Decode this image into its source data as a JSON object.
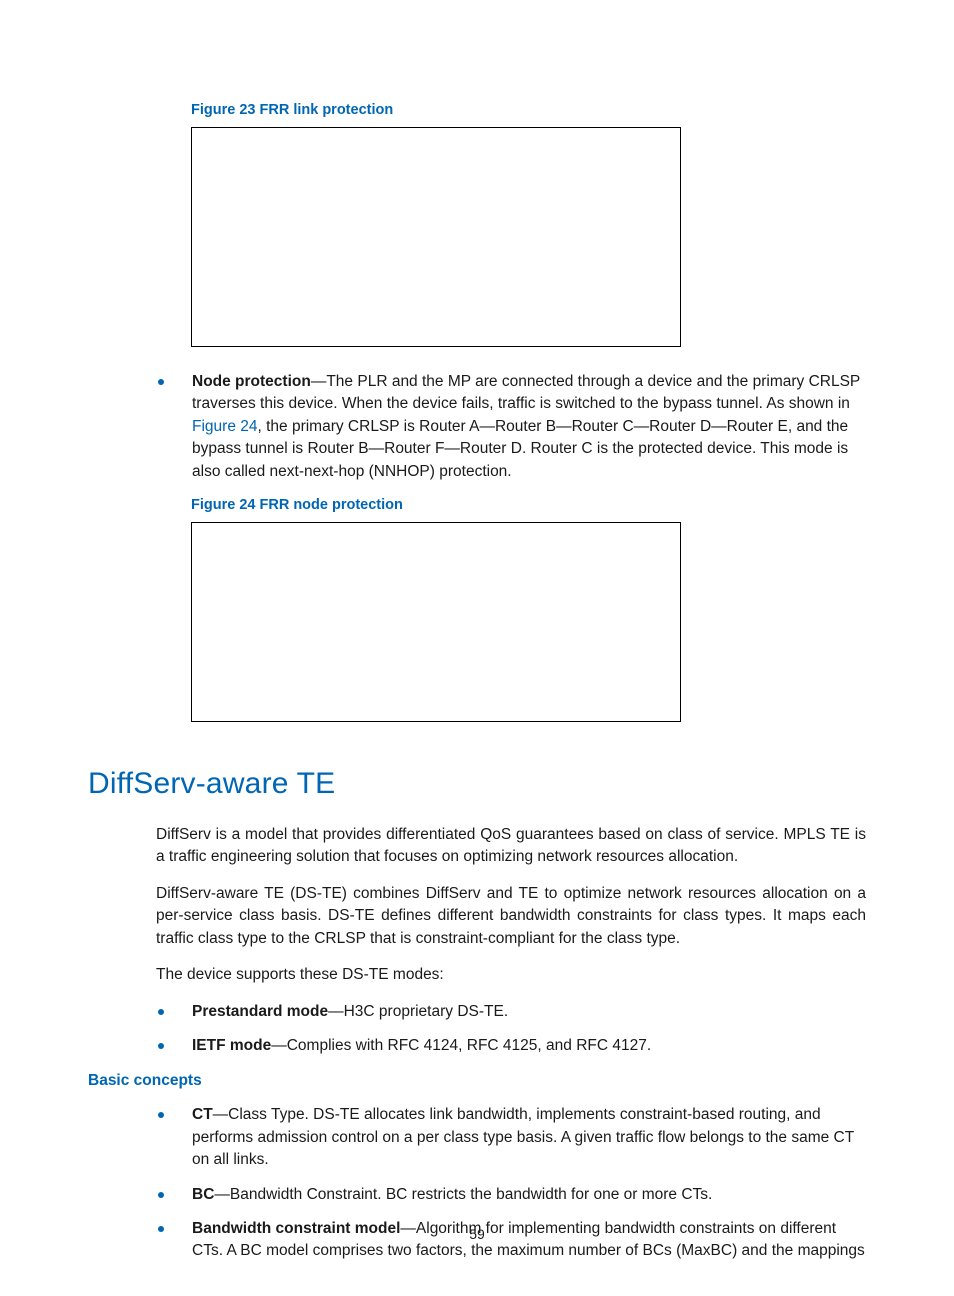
{
  "figure23_caption": "Figure 23 FRR link protection",
  "nodeProtection": {
    "label": "Node protection",
    "textA": "—The PLR and the MP are connected through a device and the primary CRLSP traverses this device. When the device fails, traffic is switched to the bypass tunnel. As shown in ",
    "link": "Figure 24",
    "textB": ", the primary CRLSP is Router A—Router B—Router C—Router D—Router E, and the bypass tunnel is Router B—Router F—Router D. Router C is the protected device. This mode is also called next-next-hop (NNHOP) protection."
  },
  "figure24_caption": "Figure 24 FRR node protection",
  "heading": "DiffServ-aware TE",
  "p1": "DiffServ is a model that provides differentiated QoS guarantees based on class of service. MPLS TE is a traffic engineering solution that focuses on optimizing network resources allocation.",
  "p2": "DiffServ-aware TE (DS-TE) combines DiffServ and TE to optimize network resources allocation on a per-service class basis. DS-TE defines different bandwidth constraints for class types. It maps each traffic class type to the CRLSP that is constraint-compliant for the class type.",
  "p3": "The device supports these DS-TE modes:",
  "modes": {
    "prestandard": {
      "label": "Prestandard mode",
      "text": "—H3C proprietary DS-TE."
    },
    "ietf": {
      "label": "IETF mode",
      "text": "—Complies with RFC 4124, RFC 4125, and RFC 4127."
    }
  },
  "basicConceptsHeading": "Basic concepts",
  "concepts": {
    "ct": {
      "label": "CT",
      "text": "—Class Type. DS-TE allocates link bandwidth, implements constraint-based routing, and performs admission control on a per class type basis. A given traffic flow belongs to the same CT on all links."
    },
    "bc": {
      "label": "BC",
      "text": "—Bandwidth Constraint. BC restricts the bandwidth for one or more CTs."
    },
    "bcm": {
      "label": "Bandwidth constraint model",
      "text": "—Algorithm for implementing bandwidth constraints on different CTs. A BC model comprises two factors, the maximum number of BCs (MaxBC) and the mappings"
    }
  },
  "pageNumber": "59"
}
